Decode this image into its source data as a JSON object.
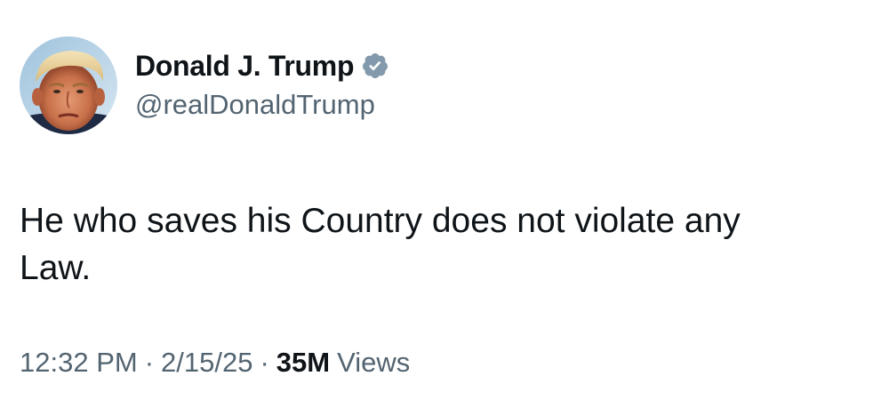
{
  "author": {
    "display_name": "Donald J. Trump",
    "handle": "@realDonaldTrump",
    "verified": true,
    "verified_badge_icon": "verified-badge-icon",
    "verified_badge_color": "#829aab",
    "avatar_icon": "profile-photo"
  },
  "tweet": {
    "text": "He who saves his Country does not violate any\nLaw."
  },
  "meta": {
    "time": "12:32 PM",
    "separator": "·",
    "date": "2/15/25",
    "views_count": "35M",
    "views_label": "Views"
  },
  "colors": {
    "primary_text": "#0f1419",
    "secondary_text": "#536471",
    "background": "#ffffff"
  }
}
